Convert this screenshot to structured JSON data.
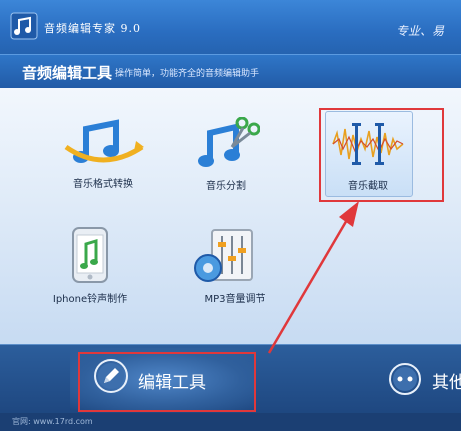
{
  "app": {
    "title": "音频编辑专家 9.0",
    "slogan": "专业、易"
  },
  "section": {
    "title": "音频编辑工具",
    "subtitle": "操作简单，功能齐全的音频编辑助手"
  },
  "tools": [
    {
      "label": "音乐格式转换",
      "icon": "music-convert-icon"
    },
    {
      "label": "音乐分割",
      "icon": "music-split-icon"
    },
    {
      "label": "音乐截取",
      "icon": "music-crop-icon"
    },
    {
      "label": "Iphone铃声制作",
      "icon": "iphone-ringtone-icon"
    },
    {
      "label": "MP3音量调节",
      "icon": "mp3-volume-icon"
    }
  ],
  "nav": {
    "edit_label": "编辑工具",
    "other_label": "其他"
  },
  "footer": {
    "text": "官网: www.17rd.com"
  },
  "colors": {
    "highlight": "#e0383b",
    "titlebar": "#2a6dc0",
    "accent": "#f0b020"
  }
}
